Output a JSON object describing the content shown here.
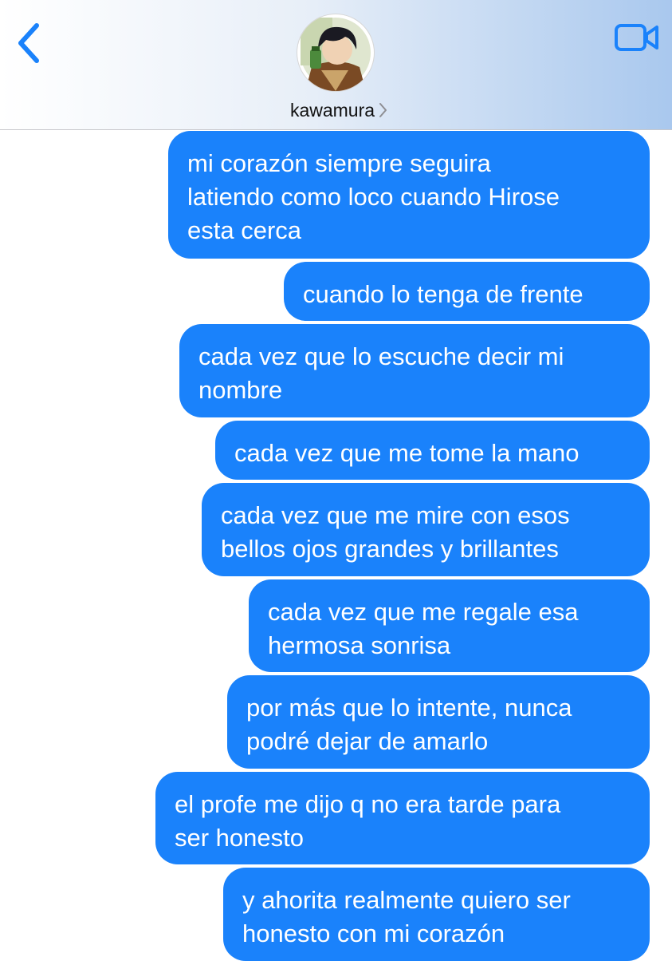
{
  "header": {
    "contact_name": "kawamura",
    "back_icon": "chevron-left-icon",
    "video_icon": "video-camera-icon",
    "detail_icon": "chevron-right-icon",
    "accent_color": "#1a82fb"
  },
  "messages": [
    {
      "lines": [
        "mi corazón siempre seguira",
        "latiendo como loco cuando Hirose",
        "esta cerca"
      ]
    },
    {
      "lines": [
        "cuando lo tenga de frente"
      ]
    },
    {
      "lines": [
        "cada vez que lo escuche decir mi",
        "nombre"
      ]
    },
    {
      "lines": [
        "cada vez que me tome la mano"
      ]
    },
    {
      "lines": [
        "cada vez que me mire con esos",
        "bellos ojos grandes y brillantes"
      ]
    },
    {
      "lines": [
        "cada vez que me regale esa",
        "hermosa sonrisa"
      ]
    },
    {
      "lines": [
        "por más que lo intente, nunca",
        "podré dejar de amarlo"
      ]
    },
    {
      "lines": [
        "el profe me dijo q no era tarde para",
        "ser honesto"
      ]
    },
    {
      "lines": [
        "y ahorita realmente quiero ser",
        "honesto con mi corazón"
      ]
    }
  ]
}
